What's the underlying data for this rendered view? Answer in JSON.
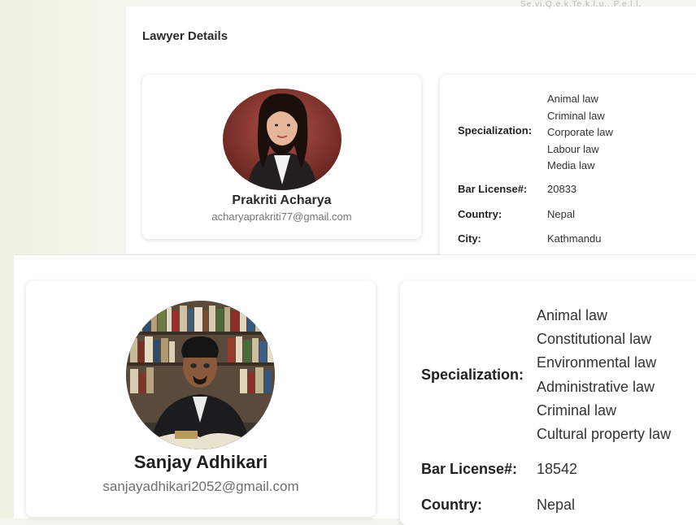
{
  "header": {
    "faded_text": "Se.vi.Q.e.k.Te.k.l.u...P.e.l.l.",
    "section_title": "Lawyer Details"
  },
  "lawyers": [
    {
      "name": "Prakriti Acharya",
      "email": "acharyaprakriti77@gmail.com",
      "labels": {
        "specialization": "Specialization:",
        "bar_license": "Bar License#:",
        "country": "Country:",
        "city": "City:"
      },
      "specializations": [
        "Animal law",
        "Criminal law",
        "Corporate law",
        "Labour law",
        "Media law"
      ],
      "bar_license": "20833",
      "country": "Nepal",
      "city": "Kathmandu"
    },
    {
      "name": "Sanjay Adhikari",
      "email": "sanjayadhikari2052@gmail.com",
      "labels": {
        "specialization": "Specialization:",
        "bar_license": "Bar License#:",
        "country": "Country:"
      },
      "specializations": [
        "Animal law",
        "Constitutional law",
        "Environmental law",
        "Administrative law",
        "Criminal law",
        "Cultural property law"
      ],
      "bar_license": "18542",
      "country": "Nepal"
    }
  ]
}
